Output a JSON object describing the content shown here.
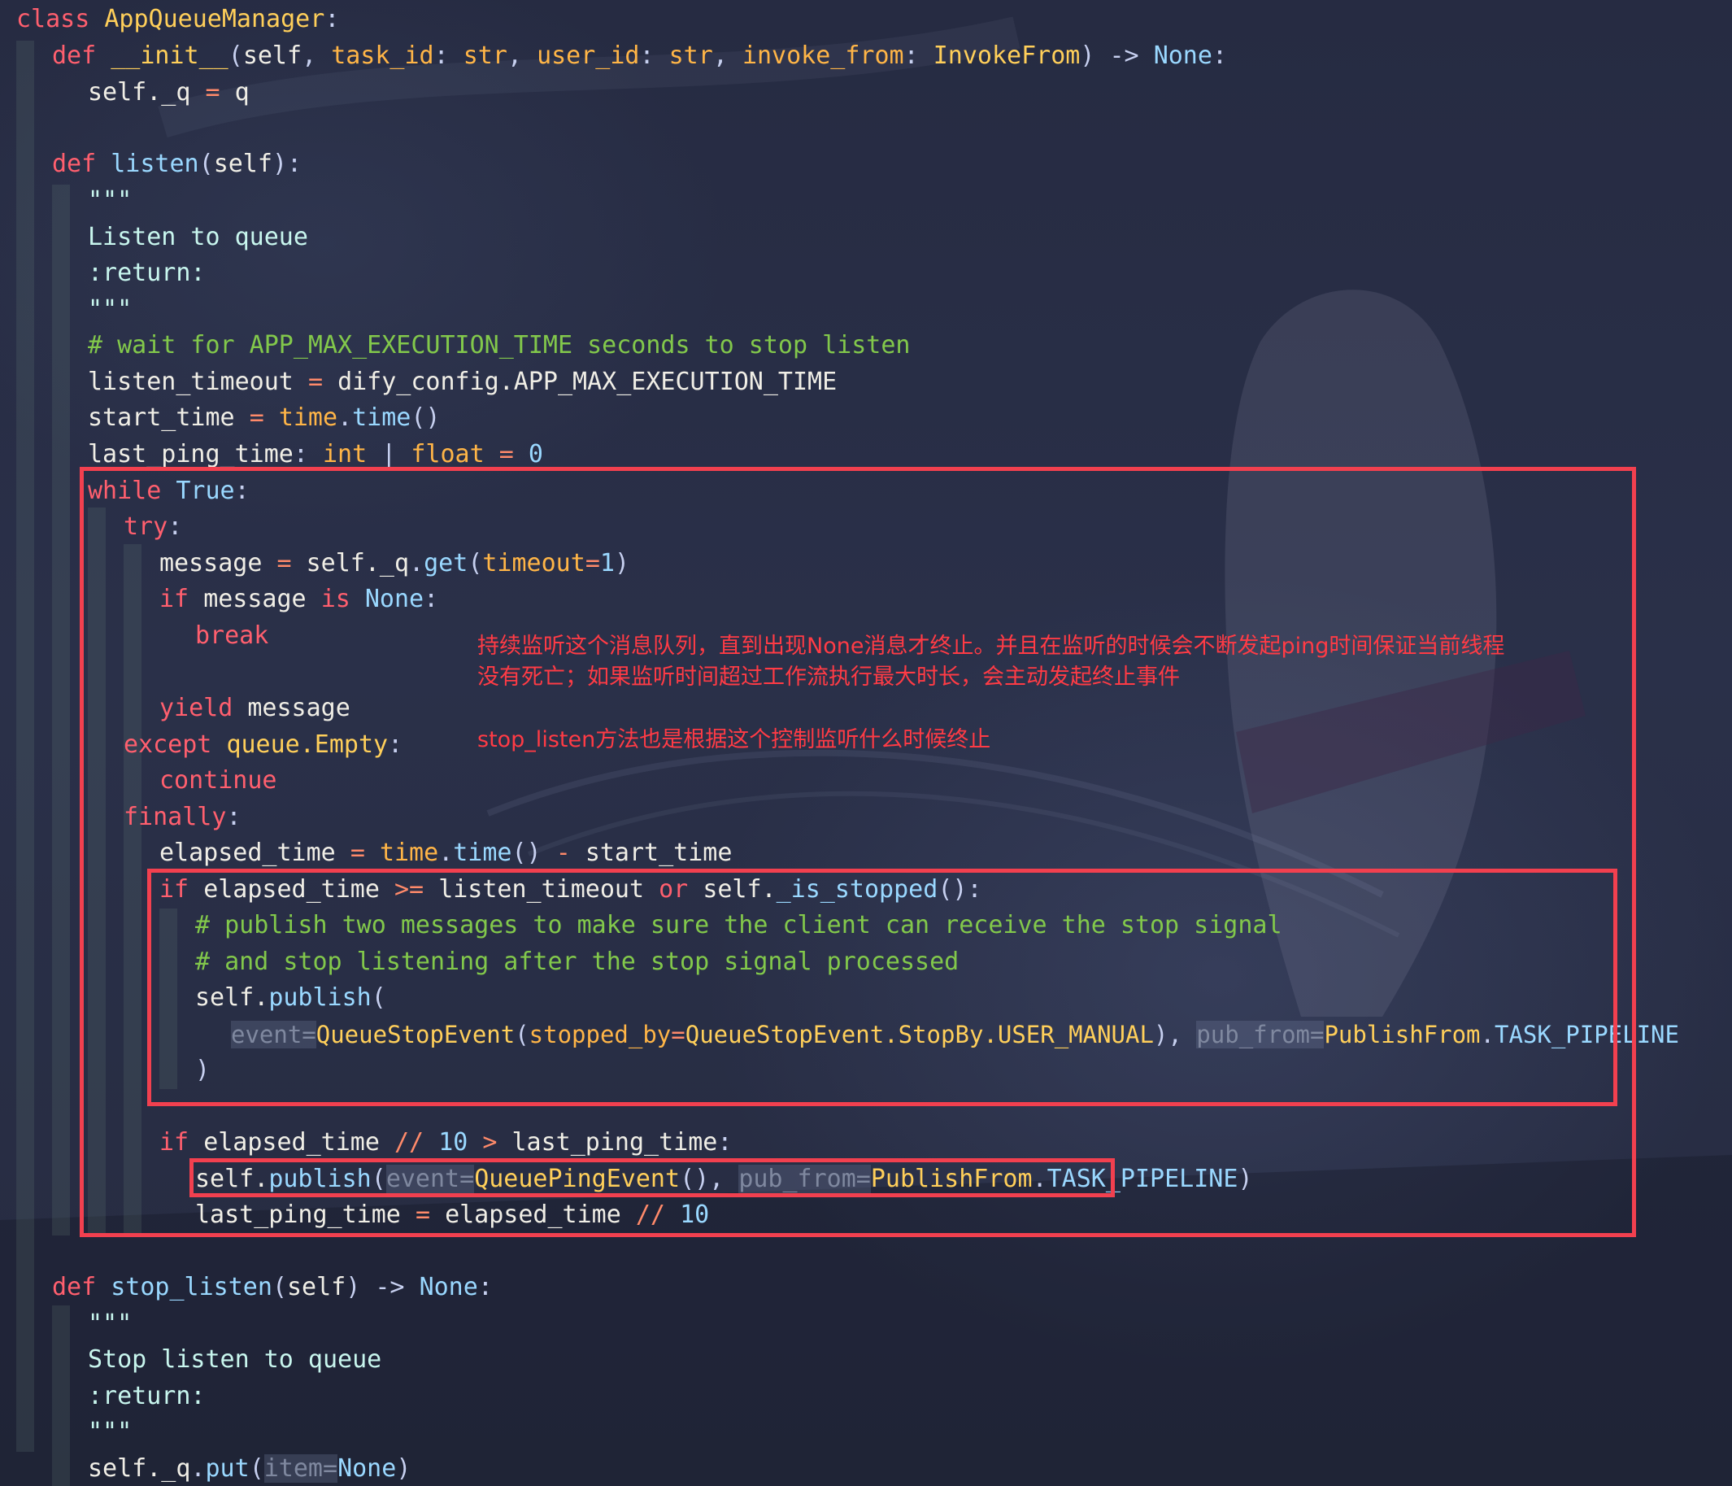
{
  "code": {
    "class_kw": "class",
    "class_name": "AppQueueManager",
    "colon": ":",
    "def_kw": "def",
    "init_name": "__init__",
    "init_params_self": "self",
    "init_param_task": "task_id",
    "init_param_user": "user_id",
    "init_param_invoke": "invoke_from",
    "type_str": "str",
    "type_invoke": "InvokeFrom",
    "arrow": "->",
    "none": "None",
    "self_q": "self._q",
    "eq": "=",
    "q_val": "q",
    "listen_name": "listen",
    "docq": "\"\"\"",
    "doc_listen": "Listen to queue",
    "doc_return": ":return:",
    "comment_wait": "# wait for APP_MAX_EXECUTION_TIME seconds to stop listen",
    "listen_timeout": "listen_timeout",
    "dify_config": "dify_config.APP_MAX_EXECUTION_TIME",
    "start_time": "start_time",
    "time_mod": "time",
    "time_fn": "time",
    "last_ping_time": "last_ping_time",
    "int_t": "int",
    "pipe": "|",
    "float_t": "float",
    "zero": "0",
    "while_kw": "while",
    "true_kw": "True",
    "try_kw": "try",
    "message": "message",
    "get_fn": "get",
    "timeout_kw": "timeout",
    "one": "1",
    "if_kw": "if",
    "is_kw": "is",
    "break_kw": "break",
    "yield_kw": "yield",
    "except_kw": "except",
    "queue_empty": "queue.Empty",
    "continue_kw": "continue",
    "finally_kw": "finally",
    "elapsed_time": "elapsed_time",
    "minus": "-",
    "gte": ">=",
    "or_kw": "or",
    "is_stopped": "_is_stopped",
    "comment_pub1": "# publish two messages to make sure the client can receive the stop signal",
    "comment_pub2": "# and stop listening after the stop signal processed",
    "self_publish": "self.",
    "publish_fn": "publish",
    "event_hint": "event=",
    "queue_stop_event": "QueueStopEvent",
    "stopped_by": "stopped_by",
    "stop_by_path": "QueueStopEvent.StopBy.USER_MANUAL",
    "pub_from_hint": "pub_from=",
    "publish_from": "PublishFrom",
    "task_pipeline": "TASK_PIPELINE",
    "floordiv": "//",
    "ten": "10",
    "gt": ">",
    "queue_ping_event": "QueuePingEvent",
    "stop_listen_name": "stop_listen",
    "doc_stop": "Stop listen to queue",
    "put_fn": "put",
    "item_hint": "item="
  },
  "annotations": {
    "line1": "持续监听这个消息队列，直到出现None消息才终止。并且在监听的时候会不断发起ping时间保证当前线程",
    "line2": "没有死亡；如果监听时间超过工作流执行最大时长，会主动发起终止事件",
    "line3": "stop_listen方法也是根据这个控制监听什么时候终止"
  },
  "colors": {
    "background": "#262b42",
    "keyword": "#ff5f6e",
    "function": "#9ad8ff",
    "type": "#ffcf5a",
    "comment": "#82c84b",
    "text": "#f0eee6",
    "highlight_box": "#f2404f",
    "annotation": "#ff3b45"
  }
}
